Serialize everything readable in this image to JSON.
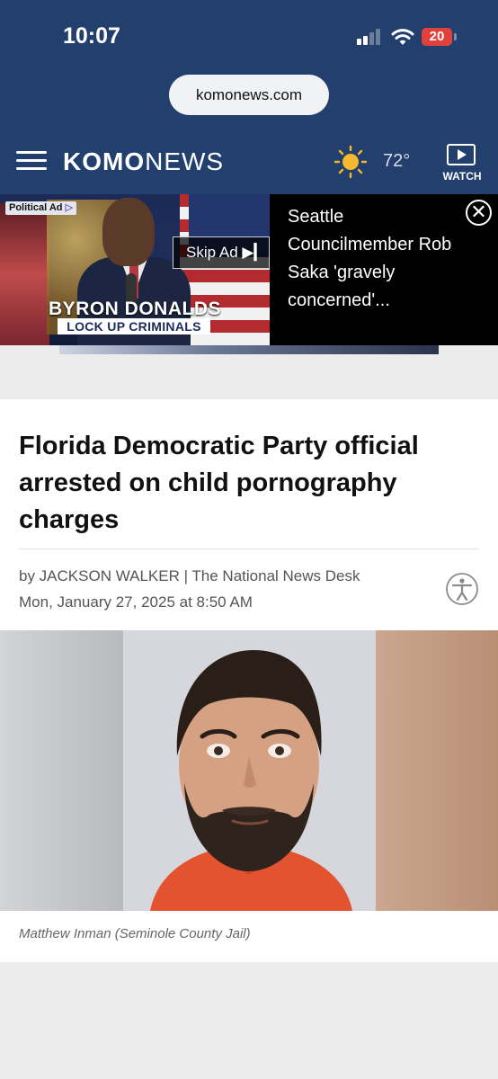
{
  "status_bar": {
    "time": "10:07",
    "battery": "20"
  },
  "browser": {
    "url": "komonews.com"
  },
  "header": {
    "logo_bold": "KOMO",
    "logo_regular": "NEWS",
    "temperature": "72°",
    "watch_label": "WATCH"
  },
  "ad": {
    "political_label": "Political Ad",
    "skip_label": "Skip Ad ▶▎",
    "candidate_name": "BYRON DONALDS",
    "slogan": "LOCK UP CRIMINALS",
    "related_headline": "Seattle Councilmember Rob Saka 'gravely concerned'..."
  },
  "article": {
    "headline": "Florida Democratic Party official arrested on child pornography charges",
    "byline": "by JACKSON WALKER | The National News Desk",
    "date": "Mon, January 27, 2025 at 8:50 AM",
    "photo_caption": "Matthew Inman (Seminole County Jail)"
  },
  "colors": {
    "header_bg": "#223f6d",
    "battery_red": "#e0413b",
    "sun_yellow": "#f5b82e"
  }
}
